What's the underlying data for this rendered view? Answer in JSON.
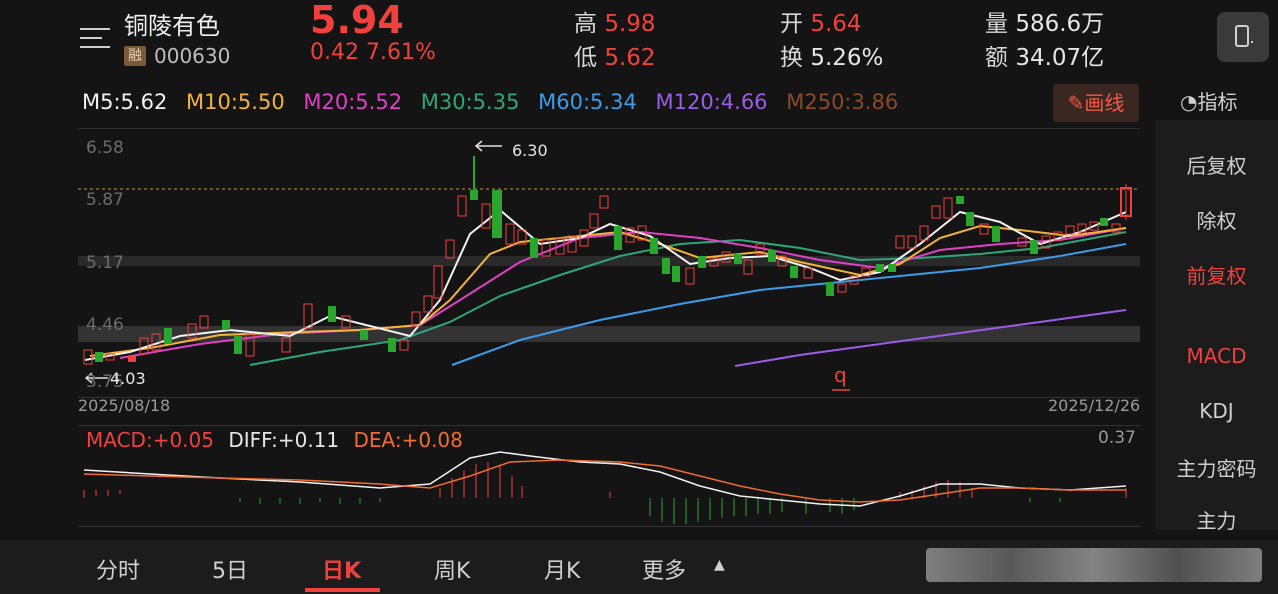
{
  "header": {
    "stock_name": "铜陵有色",
    "badge": "融",
    "stock_code": "000630",
    "price": "5.94",
    "change": "0.42  7.61%",
    "stats": [
      {
        "label": "高",
        "value": "5.98",
        "red": true
      },
      {
        "label": "开",
        "value": "5.64",
        "red": true
      },
      {
        "label": "量",
        "value": "586.6万",
        "red": false
      },
      {
        "label": "低",
        "value": "5.62",
        "red": true
      },
      {
        "label": "换",
        "value": "5.26%",
        "red": false
      },
      {
        "label": "额",
        "value": "34.07亿",
        "red": false
      }
    ]
  },
  "ma_legend": [
    {
      "text": "M5:5.62",
      "color": "#f2f2f2"
    },
    {
      "text": "M10:5.50",
      "color": "#f4b23c"
    },
    {
      "text": "M20:5.52",
      "color": "#e040c8"
    },
    {
      "text": "M30:5.35",
      "color": "#2fa57a"
    },
    {
      "text": "M60:5.34",
      "color": "#3d9be9"
    },
    {
      "text": "M120:4.66",
      "color": "#9b5de5"
    },
    {
      "text": "M250:3.86",
      "color": "#8a4a2a"
    }
  ],
  "toolbar": {
    "draw_label": "画线",
    "indicator_label": "指标"
  },
  "side_menu": [
    "后复权",
    "除权",
    "前复权",
    "MACD",
    "KDJ",
    "主力密码",
    "主力"
  ],
  "chart_data": {
    "type": "candlestick",
    "y_ticks": [
      "6.58",
      "5.87",
      "5.17",
      "4.46",
      "3.75"
    ],
    "x_start": "2025/08/18",
    "x_end": "2025/12/26",
    "max_marker": "6.30",
    "min_marker": "4.03",
    "macd": {
      "macd": "MACD:+0.05",
      "diff": "DIFF:+0.11",
      "dea": "DEA:+0.08",
      "max": "0.37"
    }
  },
  "tabs": [
    "分时",
    "5日",
    "日K",
    "周K",
    "月K",
    "更多"
  ],
  "colors": {
    "up": "#f2413d",
    "down": "#2aa52e",
    "accent": "#f2413d"
  }
}
